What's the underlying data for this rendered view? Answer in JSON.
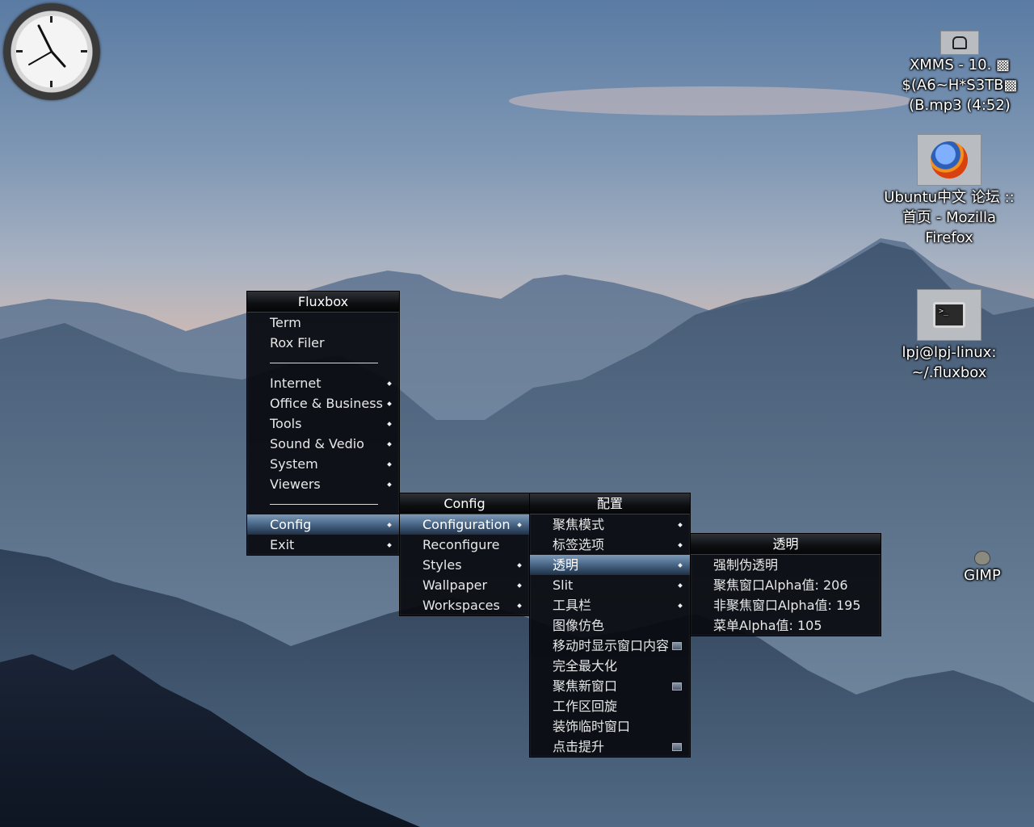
{
  "clock": {
    "hour_hand_angle_deg": 320,
    "minute_hand_angle_deg": 130
  },
  "desktop_icons": {
    "xmms": {
      "icon": "xmms-icon",
      "label_lines": [
        "XMMS - 10. ▩",
        "$(A6~H*S3TB▩",
        "(B.mp3 (4:52)"
      ]
    },
    "firefox": {
      "icon": "firefox-icon",
      "label_lines": [
        "Ubuntu中文 论坛 ::",
        "首页 - Mozilla",
        "Firefox"
      ]
    },
    "terminal": {
      "icon": "terminal-icon",
      "label_lines": [
        "lpj@lpj-linux:",
        "~/.fluxbox"
      ]
    },
    "gimp": {
      "icon": "gimp-icon",
      "label_lines": [
        "GIMP"
      ]
    }
  },
  "root_menu": {
    "title": "Fluxbox",
    "items": [
      {
        "label": "Term"
      },
      {
        "label": "Rox Filer"
      },
      {
        "label": "Internet",
        "submenu": true
      },
      {
        "label": "Office & Business",
        "submenu": true
      },
      {
        "label": "Tools",
        "submenu": true
      },
      {
        "label": "Sound & Vedio",
        "submenu": true
      },
      {
        "label": "System",
        "submenu": true
      },
      {
        "label": "Viewers",
        "submenu": true
      },
      {
        "label": "Config",
        "submenu": true,
        "selected": true
      },
      {
        "label": "Exit",
        "submenu": true
      }
    ]
  },
  "config_menu": {
    "title": "Config",
    "items": [
      {
        "label": "Configuration",
        "submenu": true,
        "selected": true
      },
      {
        "label": "Reconfigure"
      },
      {
        "label": "Styles",
        "submenu": true
      },
      {
        "label": "Wallpaper",
        "submenu": true
      },
      {
        "label": "Workspaces",
        "submenu": true
      }
    ]
  },
  "configuration_menu": {
    "title": "配置",
    "items": [
      {
        "label": "聚焦模式",
        "submenu": true
      },
      {
        "label": "标签选项",
        "submenu": true
      },
      {
        "label": "透明",
        "submenu": true,
        "selected": true
      },
      {
        "label": "Slit",
        "submenu": true
      },
      {
        "label": "工具栏",
        "submenu": true
      },
      {
        "label": "图像仿色"
      },
      {
        "label": "移动时显示窗口内容",
        "checked": true
      },
      {
        "label": "完全最大化"
      },
      {
        "label": "聚焦新窗口",
        "checked": true
      },
      {
        "label": "工作区回旋"
      },
      {
        "label": "装饰临时窗口"
      },
      {
        "label": "点击提升",
        "checked": true
      }
    ]
  },
  "transparency_menu": {
    "title": "透明",
    "items": [
      {
        "label": "强制伪透明"
      },
      {
        "label": "聚焦窗口Alpha值:  206"
      },
      {
        "label": "非聚焦窗口Alpha值:  195"
      },
      {
        "label": "菜单Alpha值:  105"
      }
    ]
  }
}
